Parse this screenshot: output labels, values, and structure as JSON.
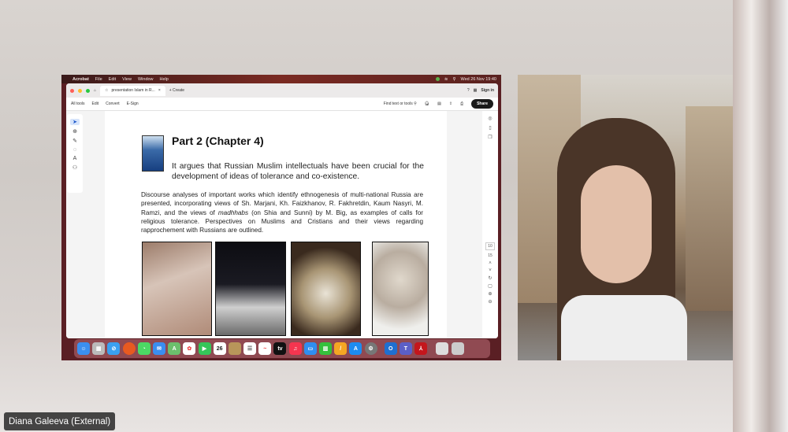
{
  "menubar": {
    "app": "Acrobat",
    "items": [
      "File",
      "Edit",
      "View",
      "Window",
      "Help"
    ],
    "datetime": "Wed 26 Nov  19:40"
  },
  "tabbar": {
    "tab_title": "presentation Islam in R...",
    "create": "+ Create",
    "sign_in": "Sign in"
  },
  "toolbar": {
    "items": [
      "All tools",
      "Edit",
      "Convert",
      "E-Sign"
    ],
    "find": "Find text or tools",
    "share": "Share"
  },
  "page_nav": {
    "current": "10",
    "total": "15"
  },
  "slide": {
    "title": "Part 2 (Chapter 4)",
    "lead": "It argues that Russian Muslim intellectuals have been crucial for the development of  ideas of tolerance and co-existence.",
    "body_pre": "Discourse analyses of important works which identify ethnogenesis of multi-national Russia are presented, incorporating views of Sh. Marjani, Kh. Faizkhanov, R. Fakhretdin, Kaum Nasyri, M. Ramzi, and the views of ",
    "body_em": "madhhabs",
    "body_post": " (on Shia and Sunni) by M. Big, as examples of calls for religious tolerance. Perspectives on Muslims and Cristians and their views regarding rapprochement with Russians are outlined."
  },
  "dock": {
    "calendar_day": "26",
    "apps": [
      "finder",
      "launchpad",
      "safari",
      "firefox",
      "messages",
      "mail",
      "maps",
      "photos",
      "facetime",
      "calendar",
      "notes-app",
      "reminders",
      "freeform",
      "tv",
      "music",
      "keynote",
      "numbers",
      "pages",
      "app-store",
      "settings",
      "outlook",
      "teams",
      "acrobat",
      "preview",
      "trash"
    ]
  },
  "participant": {
    "name": "Diana Galeeva (External)"
  }
}
